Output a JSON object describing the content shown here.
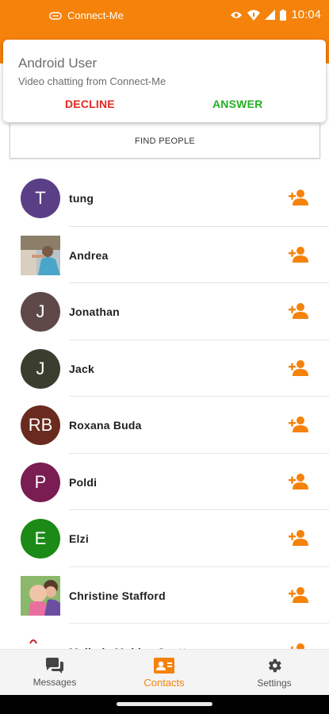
{
  "status_bar": {
    "app_name": "Connect-Me",
    "time": "10:04"
  },
  "notification": {
    "title": "Android User",
    "text": "Video chatting from Connect-Me",
    "decline_label": "DECLINE",
    "answer_label": "ANSWER"
  },
  "find_people_label": "FIND PEOPLE",
  "contacts": [
    {
      "name": "tung",
      "initials": "T",
      "color": "#5b3f86"
    },
    {
      "name": "Andrea",
      "initials": "",
      "color": ""
    },
    {
      "name": "Jonathan",
      "initials": "J",
      "color": "#5e4948"
    },
    {
      "name": "Jack",
      "initials": "J",
      "color": "#3b3d2f"
    },
    {
      "name": "Roxana Buda",
      "initials": "RB",
      "color": "#6a2a1e"
    },
    {
      "name": "Poldi",
      "initials": "P",
      "color": "#7a1d52"
    },
    {
      "name": "Elzi",
      "initials": "E",
      "color": "#1c8a16"
    },
    {
      "name": "Christine Stafford",
      "initials": "",
      "color": ""
    },
    {
      "name": "Melinda Molden Scott",
      "initials": "",
      "color": ""
    }
  ],
  "bottom_nav": {
    "messages": "Messages",
    "contacts": "Contacts",
    "settings": "Settings"
  },
  "colors": {
    "accent": "#f5820a",
    "decline": "#e8251f",
    "answer": "#22b022"
  }
}
